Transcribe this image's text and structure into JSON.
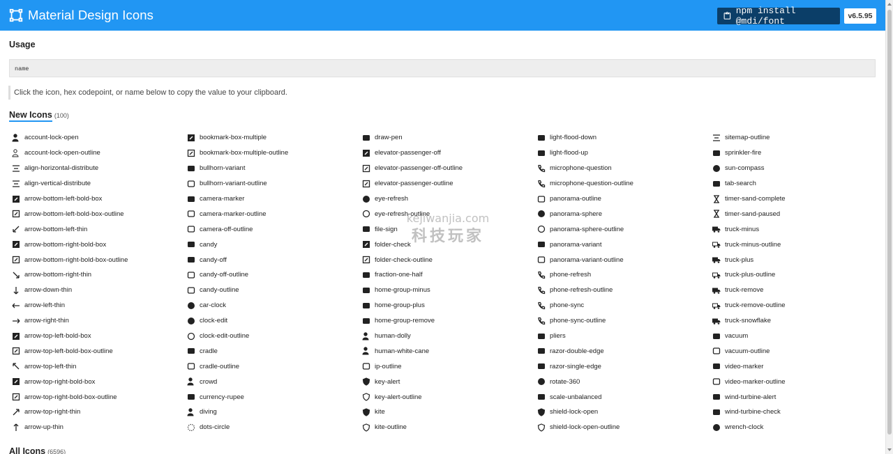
{
  "header": {
    "title": "Material Design Icons",
    "npm_command": "npm install @mdi/font",
    "version": "v6.5.95"
  },
  "usage": {
    "heading": "Usage",
    "code": "name",
    "hint": "Click the icon, hex codepoint, or name below to copy the value to your clipboard."
  },
  "new_icons": {
    "heading": "New Icons",
    "count": "(100)",
    "items": [
      "account-lock-open",
      "account-lock-open-outline",
      "align-horizontal-distribute",
      "align-vertical-distribute",
      "arrow-bottom-left-bold-box",
      "arrow-bottom-left-bold-box-outline",
      "arrow-bottom-left-thin",
      "arrow-bottom-right-bold-box",
      "arrow-bottom-right-bold-box-outline",
      "arrow-bottom-right-thin",
      "arrow-down-thin",
      "arrow-left-thin",
      "arrow-right-thin",
      "arrow-top-left-bold-box",
      "arrow-top-left-bold-box-outline",
      "arrow-top-left-thin",
      "arrow-top-right-bold-box",
      "arrow-top-right-bold-box-outline",
      "arrow-top-right-thin",
      "arrow-up-thin",
      "bookmark-box-multiple",
      "bookmark-box-multiple-outline",
      "bullhorn-variant",
      "bullhorn-variant-outline",
      "camera-marker",
      "camera-marker-outline",
      "camera-off-outline",
      "candy",
      "candy-off",
      "candy-off-outline",
      "candy-outline",
      "car-clock",
      "clock-edit",
      "clock-edit-outline",
      "cradle",
      "cradle-outline",
      "crowd",
      "currency-rupee",
      "diving",
      "dots-circle",
      "draw-pen",
      "elevator-passenger-off",
      "elevator-passenger-off-outline",
      "elevator-passenger-outline",
      "eye-refresh",
      "eye-refresh-outline",
      "file-sign",
      "folder-check",
      "folder-check-outline",
      "fraction-one-half",
      "home-group-minus",
      "home-group-plus",
      "home-group-remove",
      "human-dolly",
      "human-white-cane",
      "ip-outline",
      "key-alert",
      "key-alert-outline",
      "kite",
      "kite-outline",
      "light-flood-down",
      "light-flood-up",
      "microphone-question",
      "microphone-question-outline",
      "panorama-outline",
      "panorama-sphere",
      "panorama-sphere-outline",
      "panorama-variant",
      "panorama-variant-outline",
      "phone-refresh",
      "phone-refresh-outline",
      "phone-sync",
      "phone-sync-outline",
      "pliers",
      "razor-double-edge",
      "razor-single-edge",
      "rotate-360",
      "scale-unbalanced",
      "shield-lock-open",
      "shield-lock-open-outline",
      "sitemap-outline",
      "sprinkler-fire",
      "sun-compass",
      "tab-search",
      "timer-sand-complete",
      "timer-sand-paused",
      "truck-minus",
      "truck-minus-outline",
      "truck-plus",
      "truck-plus-outline",
      "truck-remove",
      "truck-remove-outline",
      "truck-snowflake",
      "vacuum",
      "vacuum-outline",
      "video-marker",
      "video-marker-outline",
      "wind-turbine-alert",
      "wind-turbine-check",
      "wrench-clock"
    ]
  },
  "all_icons": {
    "heading": "All Icons",
    "count": "(6596)"
  },
  "watermark": {
    "line1": "kejiwanjia.com",
    "line2": "科技玩家"
  },
  "colors": {
    "header_bg": "#2196f3",
    "npm_button_bg": "#0b3e68",
    "accent_underline": "#2196f3"
  }
}
